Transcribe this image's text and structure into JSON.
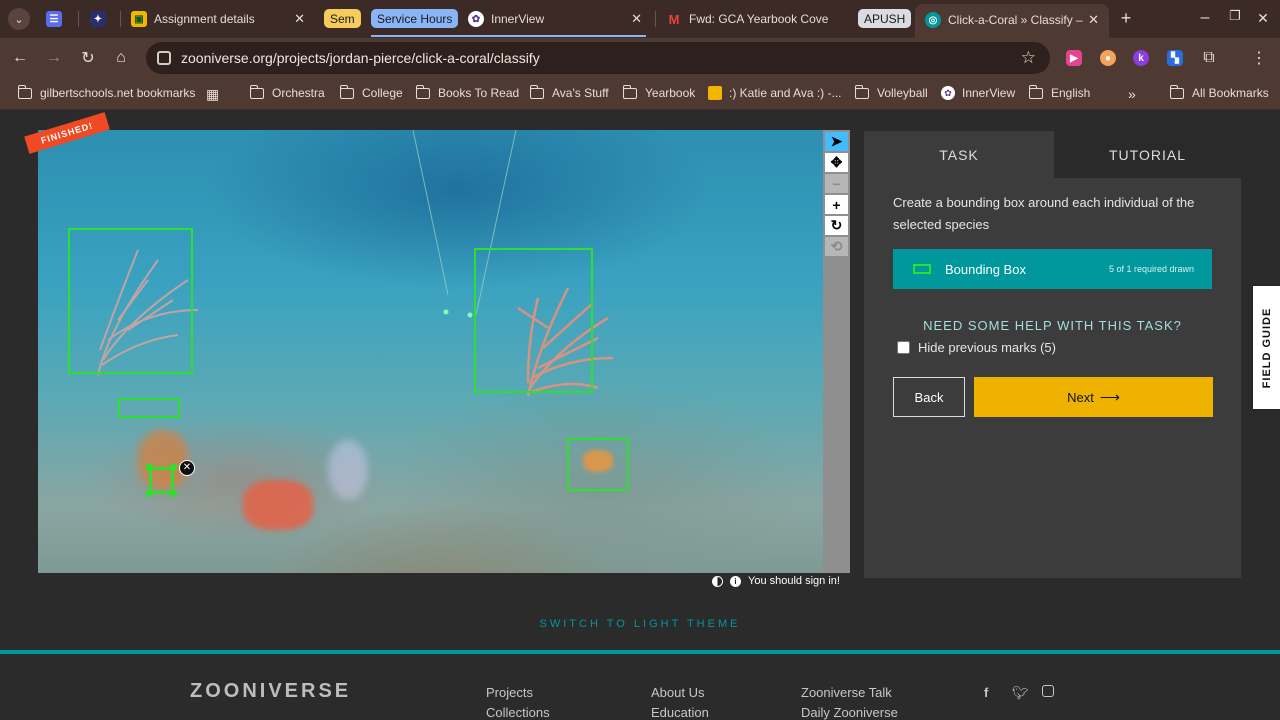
{
  "browser": {
    "tabs": [
      {
        "id": "docs",
        "title": ""
      },
      {
        "id": "assignment",
        "title": "Assignment details"
      },
      {
        "id": "innerview",
        "title": "InnerView"
      },
      {
        "id": "gmail",
        "title": "Fwd: GCA Yearbook Cove"
      },
      {
        "id": "zooniverse",
        "title": "Click-a-Coral » Classify –"
      }
    ],
    "groups": {
      "sem": "Sem",
      "service": "Service Hours",
      "apush": "APUSH"
    },
    "url": "zooniverse.org/projects/jordan-pierce/click-a-coral/classify",
    "bookmarks": [
      "gilbertschools.net bookmarks",
      "Orchestra",
      "College",
      "Books To Read",
      "Ava's Stuff",
      "Yearbook",
      ":) Katie and Ava :) -...",
      "Volleyball",
      "InnerView",
      "English",
      "All Bookmarks"
    ],
    "colors": {
      "frame": "#3b2a25",
      "toolbar": "#4f3a33"
    }
  },
  "classifier": {
    "finished_banner": "FINISHED!",
    "sign_in_note": "You should sign in!",
    "tools": [
      "pointer-icon",
      "move-icon",
      "zoom-out-icon",
      "zoom-in-icon",
      "rotate-icon",
      "reset-icon"
    ]
  },
  "task": {
    "tab_task": "TASK",
    "tab_tutorial": "TUTORIAL",
    "instruction": "Create a bounding box around each individual of the selected species",
    "tool_label": "Bounding Box",
    "tool_count": "5 of 1 required drawn",
    "help": "NEED SOME HELP WITH THIS TASK?",
    "hide_marks": "Hide previous marks (5)",
    "back": "Back",
    "next": "Next",
    "field_guide": "FIELD GUIDE",
    "colors": {
      "accent": "#00979d",
      "next": "#f0b200",
      "mark": "#2ee02e"
    }
  },
  "page": {
    "theme_toggle": "SWITCH TO LIGHT THEME"
  },
  "footer": {
    "logo": "ZOONIVERSE",
    "col1": [
      "Projects",
      "Collections"
    ],
    "col2": [
      "About Us",
      "Education"
    ],
    "col3": [
      "Zooniverse Talk",
      "Daily Zooniverse"
    ],
    "social": [
      "facebook-icon",
      "twitter-icon",
      "instagram-icon"
    ]
  }
}
